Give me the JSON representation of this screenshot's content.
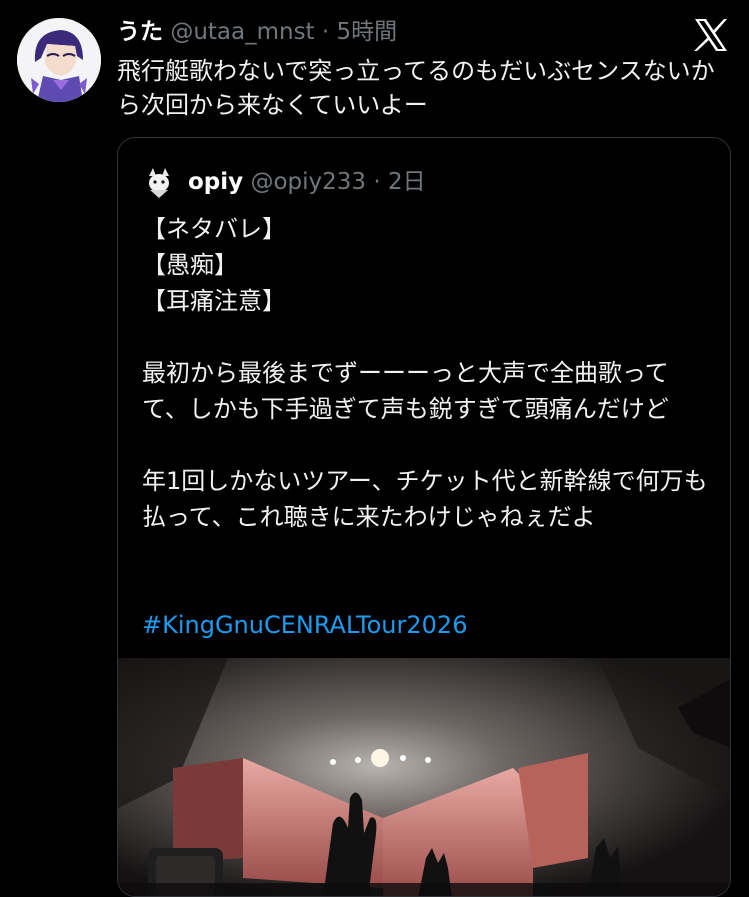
{
  "tweet": {
    "author_name": "うた",
    "handle": "@utaa_mnst",
    "separator": "·",
    "time": "5時間",
    "text": "飛行艇歌わないで突っ立ってるのもだいぶセンスないから次回から来なくていいよー"
  },
  "icons": [
    "x-logo-icon",
    "avatar",
    "quoted-avatar"
  ],
  "quote": {
    "author_name": "opiy",
    "handle": "@opiy233",
    "separator": "·",
    "time": "2日",
    "body": "【ネタバレ】\n【愚痴】\n【耳痛注意】\n\n最初から最後までずーーーっと大声で全曲歌ってて、しかも下手過ぎて声も鋭すぎて頭痛んだけど\n\n年1回しかないツアー、チケット代と新幹線で何万も払って、これ聴きに来たわけじゃねぇだよ",
    "hashtag": "#KingGnuCENRALTour2026"
  },
  "colors": {
    "background": "#000000",
    "text": "#e7e9ea",
    "muted": "#71767b",
    "link": "#1d9bf0",
    "border": "#2f3336"
  }
}
